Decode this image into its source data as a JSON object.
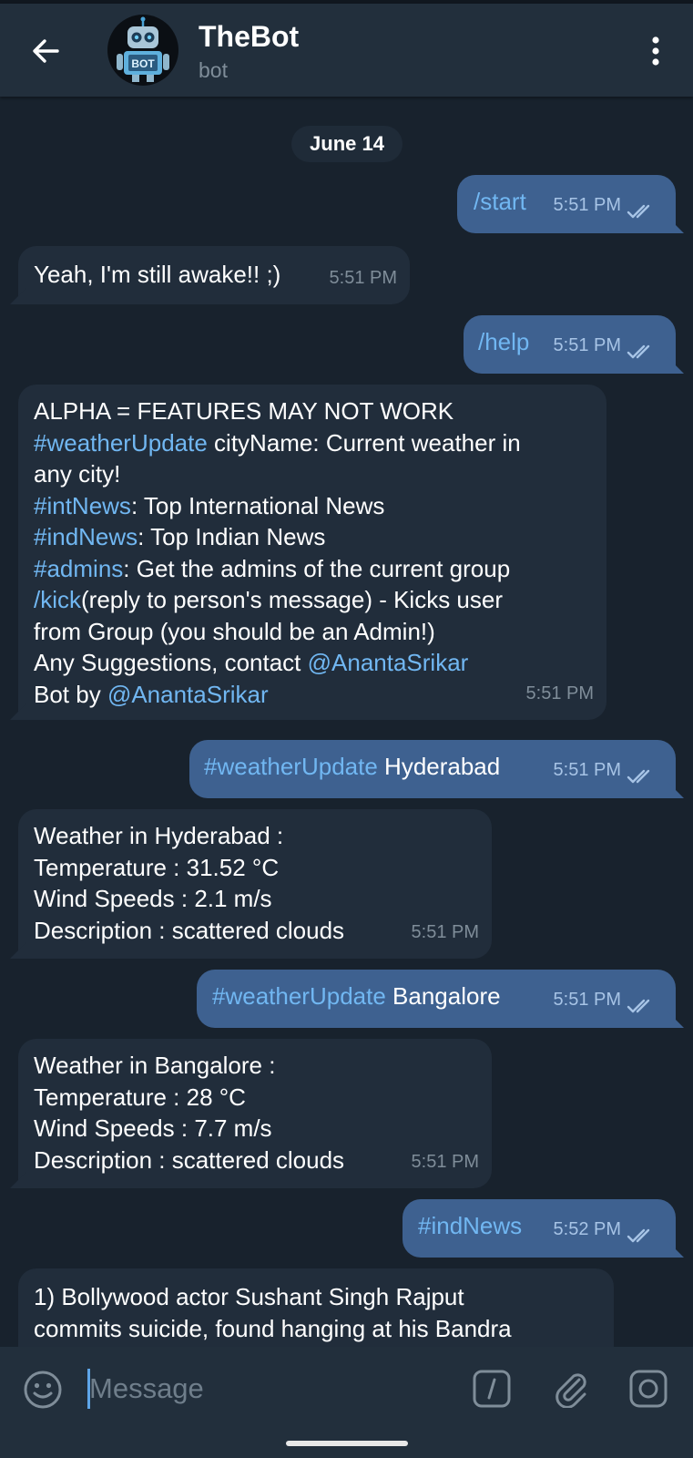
{
  "header": {
    "title": "TheBot",
    "subtitle": "bot",
    "avatar_text": "BOT",
    "back_icon": "back-arrow-icon",
    "menu_icon": "more-vertical-icon"
  },
  "chat": {
    "date": "June 14",
    "messages": [
      {
        "dir": "out",
        "parts": [
          {
            "t": "/start",
            "link": true
          }
        ],
        "time": "5:51 PM",
        "read": true
      },
      {
        "dir": "in",
        "parts": [
          {
            "t": "Yeah, I'm still awake!! ;)"
          }
        ],
        "time": "5:51 PM"
      },
      {
        "dir": "out",
        "parts": [
          {
            "t": "/help",
            "link": true
          }
        ],
        "time": "5:51 PM",
        "read": true
      },
      {
        "dir": "in",
        "lines": [
          [
            {
              "t": "ALPHA = FEATURES MAY NOT WORK"
            }
          ],
          [
            {
              "t": "#weatherUpdate",
              "link": true
            },
            {
              "t": " cityName: Current weather in"
            }
          ],
          [
            {
              "t": "any city!"
            }
          ],
          [
            {
              "t": "#intNews",
              "link": true
            },
            {
              "t": ": Top International News"
            }
          ],
          [
            {
              "t": "#indNews",
              "link": true
            },
            {
              "t": ": Top Indian News"
            }
          ],
          [
            {
              "t": "#admins",
              "link": true
            },
            {
              "t": ": Get the admins of the current group"
            }
          ],
          [
            {
              "t": "/kick",
              "link": true
            },
            {
              "t": "(reply to person's message) - Kicks user"
            }
          ],
          [
            {
              "t": "from Group (you should be an Admin!)"
            }
          ],
          [
            {
              "t": "Any Suggestions, contact "
            },
            {
              "t": "@AnantaSrikar",
              "link": true
            }
          ],
          [
            {
              "t": "Bot by "
            },
            {
              "t": "@AnantaSrikar",
              "link": true
            }
          ]
        ],
        "time": "5:51 PM"
      },
      {
        "dir": "out",
        "parts": [
          {
            "t": "#weatherUpdate",
            "link": true
          },
          {
            "t": " Hyderabad"
          }
        ],
        "time": "5:51 PM",
        "read": true
      },
      {
        "dir": "in",
        "lines": [
          [
            {
              "t": "Weather in Hyderabad :"
            }
          ],
          [
            {
              "t": "Temperature : 31.52 °C"
            }
          ],
          [
            {
              "t": "Wind Speeds : 2.1 m/s"
            }
          ],
          [
            {
              "t": "Description : scattered clouds"
            }
          ]
        ],
        "time": "5:51 PM"
      },
      {
        "dir": "out",
        "parts": [
          {
            "t": "#weatherUpdate",
            "link": true
          },
          {
            "t": " Bangalore"
          }
        ],
        "time": "5:51 PM",
        "read": true
      },
      {
        "dir": "in",
        "lines": [
          [
            {
              "t": "Weather in Bangalore :"
            }
          ],
          [
            {
              "t": "Temperature : 28 °C"
            }
          ],
          [
            {
              "t": "Wind Speeds : 7.7 m/s"
            }
          ],
          [
            {
              "t": "Description : scattered clouds"
            }
          ]
        ],
        "time": "5:51 PM"
      },
      {
        "dir": "out",
        "parts": [
          {
            "t": "#indNews",
            "link": true
          }
        ],
        "time": "5:52 PM",
        "read": true
      },
      {
        "dir": "in",
        "lines": [
          [
            {
              "t": "1) Bollywood actor Sushant Singh Rajput"
            }
          ],
          [
            {
              "t": "commits suicide, found hanging at his Bandra"
            }
          ]
        ],
        "time": ""
      }
    ]
  },
  "input": {
    "placeholder": "Message",
    "emoji_icon": "emoji-icon",
    "command_icon": "slash-command-icon",
    "attach_icon": "paperclip-icon",
    "camera_icon": "camera-icon"
  },
  "colors": {
    "background": "#18222d",
    "header": "#222f3c",
    "incoming_bubble": "#212d3b",
    "outgoing_bubble": "#3e6190",
    "link": "#71b7f2",
    "timestamp": "#7f8d99"
  }
}
